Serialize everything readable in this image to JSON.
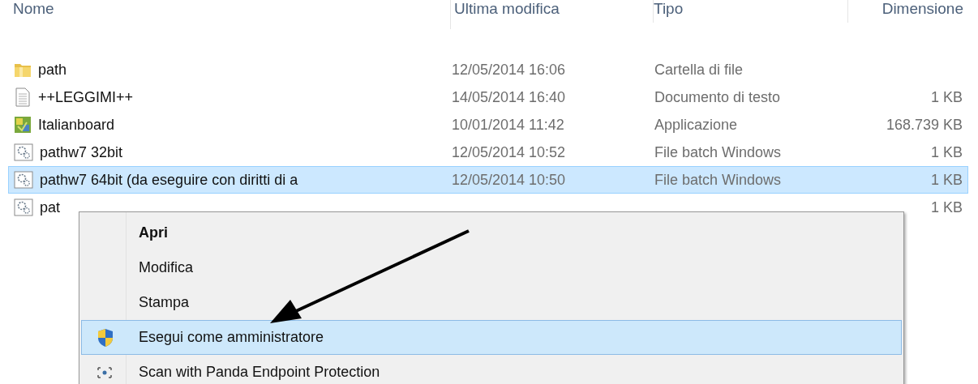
{
  "columns": [
    {
      "label": "Nome"
    },
    {
      "label": "Ultima modifica"
    },
    {
      "label": "Tipo"
    },
    {
      "label": "Dimensione"
    }
  ],
  "files": [
    {
      "name": "path",
      "modified": "12/05/2014 16:06",
      "type": "Cartella di file",
      "kind": "folder",
      "selected": false
    },
    {
      "name": "++LEGGIMI++",
      "modified": "14/05/2014 16:40",
      "type": "Documento di testo",
      "size": "1 KB",
      "kind": "text",
      "selected": false
    },
    {
      "name": "Italianboard",
      "modified": "10/01/2014 11:42",
      "type": "Applicazione",
      "size": "168.739 KB",
      "kind": "app",
      "selected": false
    },
    {
      "name": "pathw7 32bit",
      "modified": "12/05/2014 10:52",
      "type": "File batch Windows",
      "size": "1 KB",
      "kind": "batch",
      "selected": false
    },
    {
      "name": "pathw7 64bit (da eseguire con diritti di a",
      "modified": "12/05/2014 10:50",
      "type": "File batch Windows",
      "size": "1 KB",
      "kind": "batch",
      "selected": true
    },
    {
      "name": "pat",
      "size": "1 KB",
      "kind": "batch",
      "selected": false
    }
  ],
  "context_menu": {
    "items": [
      {
        "label": "Apri",
        "default": true,
        "selected": false
      },
      {
        "label": "Modifica",
        "default": false,
        "selected": false
      },
      {
        "label": "Stampa",
        "default": false,
        "selected": false
      },
      {
        "label": "Esegui come amministratore",
        "kind": "shield",
        "default": false,
        "selected": true
      },
      {
        "label": "Scan with Panda Endpoint Protection",
        "kind": "scan",
        "default": false,
        "selected": false
      }
    ]
  }
}
